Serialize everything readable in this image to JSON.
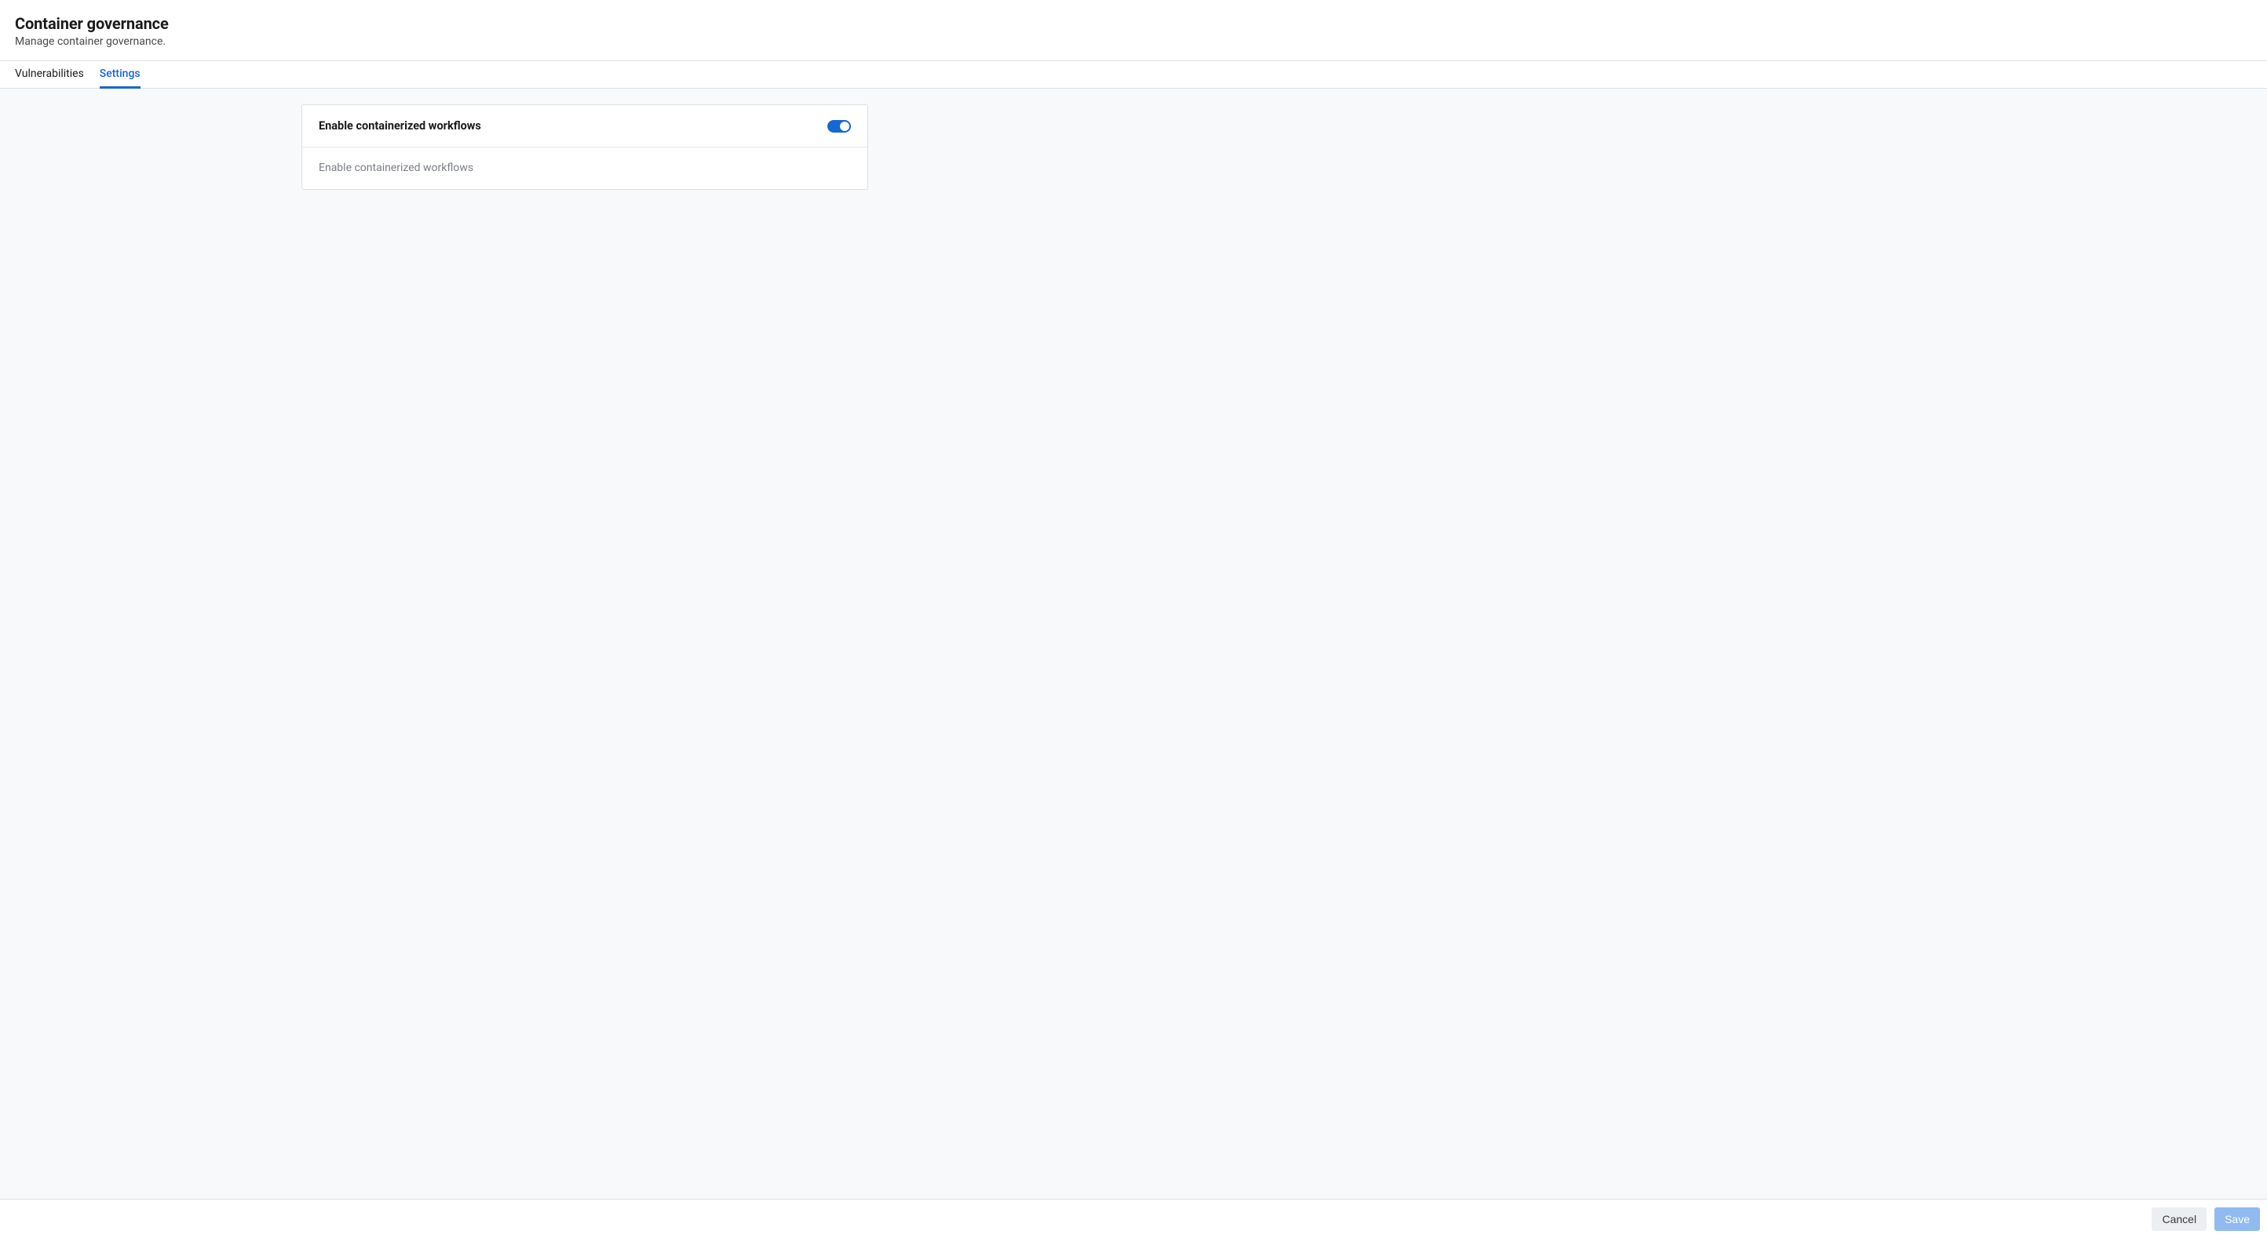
{
  "header": {
    "title": "Container governance",
    "subtitle": "Manage container governance."
  },
  "tabs": [
    {
      "label": "Vulnerabilities",
      "active": false
    },
    {
      "label": "Settings",
      "active": true
    }
  ],
  "card": {
    "header_title": "Enable containerized workflows",
    "body_text": "Enable containerized workflows",
    "toggle_on": true
  },
  "footer": {
    "cancel_label": "Cancel",
    "save_label": "Save"
  }
}
